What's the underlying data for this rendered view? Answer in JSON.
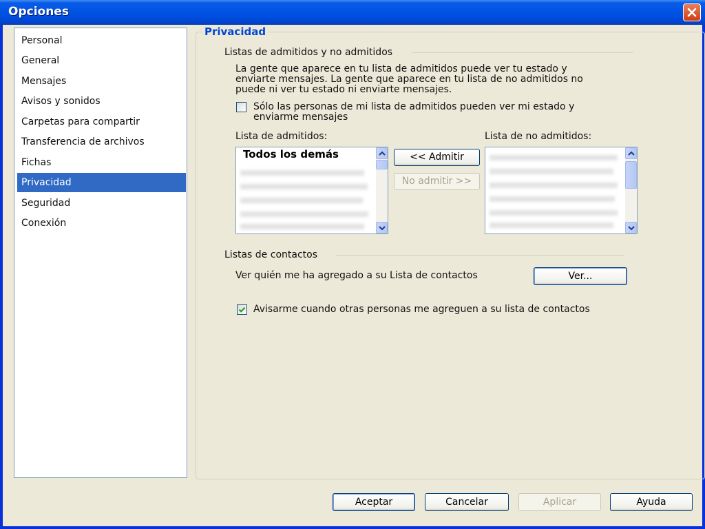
{
  "window": {
    "title": "Opciones"
  },
  "sidebar": {
    "items": [
      {
        "label": "Personal",
        "selected": false
      },
      {
        "label": "General",
        "selected": false
      },
      {
        "label": "Mensajes",
        "selected": false
      },
      {
        "label": "Avisos y sonidos",
        "selected": false
      },
      {
        "label": "Carpetas para compartir",
        "selected": false
      },
      {
        "label": "Transferencia de archivos",
        "selected": false
      },
      {
        "label": "Fichas",
        "selected": false
      },
      {
        "label": "Privacidad",
        "selected": true
      },
      {
        "label": "Seguridad",
        "selected": false
      },
      {
        "label": "Conexión",
        "selected": false
      }
    ]
  },
  "panel": {
    "title": "Privacidad",
    "allow_block": {
      "group_title": "Listas de admitidos y no admitidos",
      "description_lines": [
        "La gente que aparece en tu lista de admitidos puede ver tu estado y",
        "enviarte mensajes. La gente que aparece en tu lista de no admitidos no",
        "puede ni ver tu estado ni enviarte mensajes."
      ],
      "only_allowed_checkbox": {
        "checked": false,
        "label_lines": [
          "Sólo las personas de mi lista de admitidos pueden ver mi estado y",
          "enviarme mensajes"
        ]
      },
      "allow_list": {
        "label": "Lista de admitidos:",
        "first_item": "Todos los demás"
      },
      "block_list": {
        "label": "Lista de no admitidos:"
      },
      "allow_button": "<< Admitir",
      "block_button": "No admitir >>"
    },
    "contacts": {
      "group_title": "Listas de contactos",
      "view_text": "Ver quién me ha agregado a su Lista de contactos",
      "view_button": "Ver...",
      "notify_checkbox": {
        "checked": true,
        "label": "Avisarme cuando otras personas me agreguen a su lista de contactos"
      }
    }
  },
  "footer": {
    "ok": "Aceptar",
    "cancel": "Cancelar",
    "apply": "Aplicar",
    "help": "Ayuda"
  },
  "colors": {
    "titlebar": "#0054e3",
    "selection": "#316ac5",
    "panel_title": "#0046d5",
    "dialog_bg": "#ece9d8"
  }
}
